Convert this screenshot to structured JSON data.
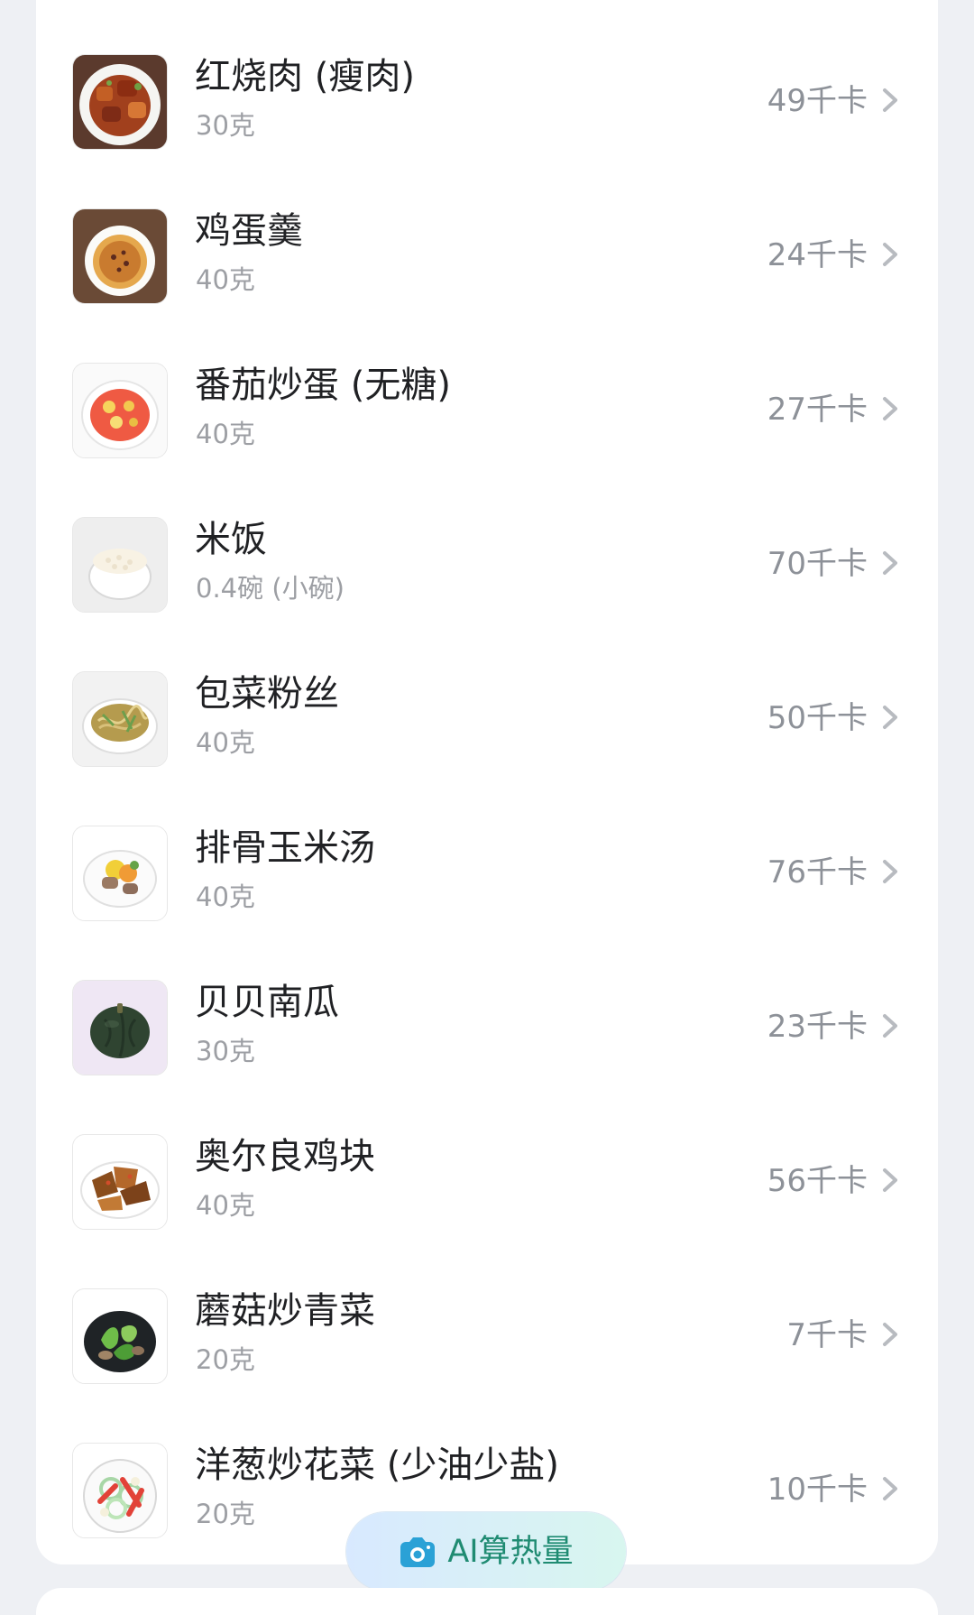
{
  "food_list": {
    "items": [
      {
        "name": "红烧肉 (瘦肉)",
        "amount": "30克",
        "calories": "49千卡",
        "thumb_icon": "braised-pork-icon"
      },
      {
        "name": "鸡蛋羹",
        "amount": "40克",
        "calories": "24千卡",
        "thumb_icon": "steamed-egg-custard-icon"
      },
      {
        "name": "番茄炒蛋 (无糖)",
        "amount": "40克",
        "calories": "27千卡",
        "thumb_icon": "tomato-egg-icon"
      },
      {
        "name": "米饭",
        "amount": "0.4碗 (小碗)",
        "calories": "70千卡",
        "thumb_icon": "rice-bowl-icon"
      },
      {
        "name": "包菜粉丝",
        "amount": "40克",
        "calories": "50千卡",
        "thumb_icon": "cabbage-vermicelli-icon"
      },
      {
        "name": "排骨玉米汤",
        "amount": "40克",
        "calories": "76千卡",
        "thumb_icon": "rib-corn-soup-icon"
      },
      {
        "name": "贝贝南瓜",
        "amount": "30克",
        "calories": "23千卡",
        "thumb_icon": "pumpkin-icon"
      },
      {
        "name": "奥尔良鸡块",
        "amount": "40克",
        "calories": "56千卡",
        "thumb_icon": "orleans-chicken-icon"
      },
      {
        "name": "蘑菇炒青菜",
        "amount": "20克",
        "calories": "7千卡",
        "thumb_icon": "mushroom-greens-icon"
      },
      {
        "name": "洋葱炒花菜 (少油少盐)",
        "amount": "20克",
        "calories": "10千卡",
        "thumb_icon": "onion-cauliflower-icon"
      }
    ]
  },
  "actions": {
    "ai_calorie_label": "AI算热量",
    "camera_icon": "camera-icon"
  },
  "colors": {
    "accent": "#1f8b72",
    "muted": "#9d9fa4",
    "background": "#eef0f4"
  }
}
